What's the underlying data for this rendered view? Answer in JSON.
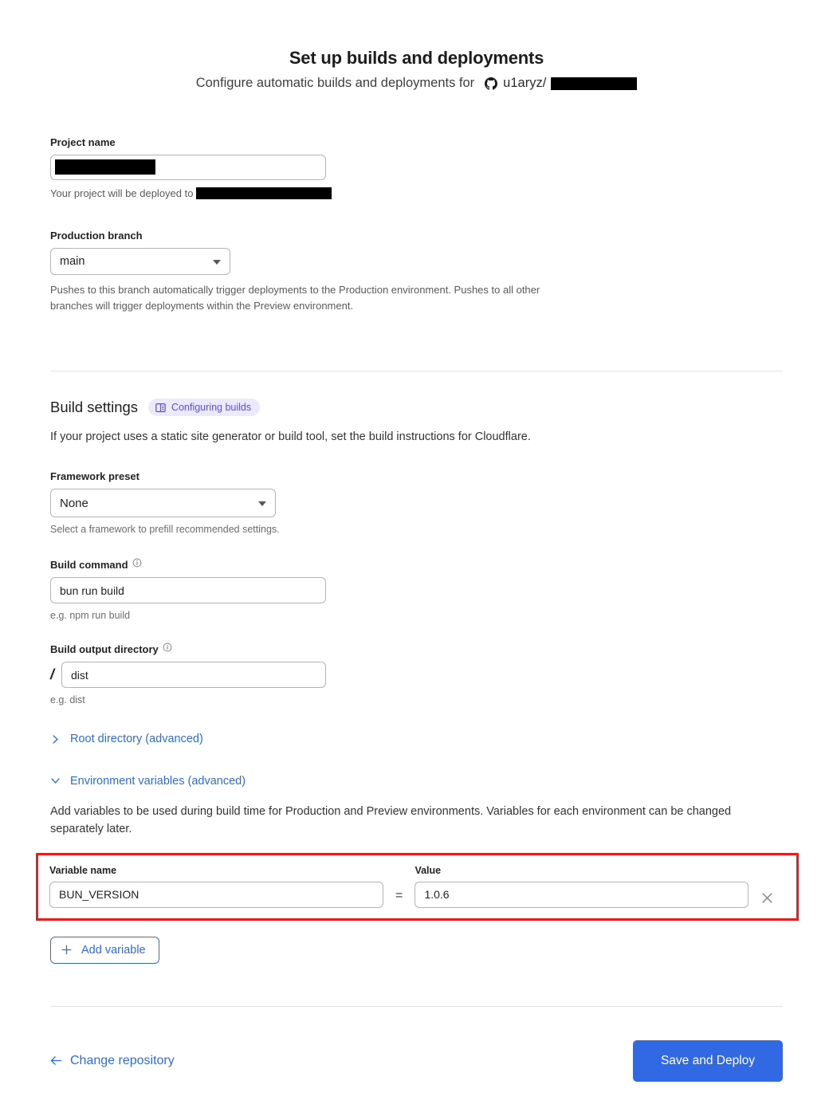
{
  "header": {
    "title": "Set up builds and deployments",
    "subtitle_text": "Configure automatic builds and deployments for",
    "repo_icon": "github-icon",
    "repo_owner": "u1aryz/",
    "repo_name_redacted": true
  },
  "project": {
    "label": "Project name",
    "value": "",
    "value_redacted": true,
    "deploy_note": "Your project will be deployed to",
    "deploy_target_redacted": true
  },
  "production_branch": {
    "label": "Production branch",
    "value": "main",
    "options": [
      "main"
    ],
    "helper": "Pushes to this branch automatically trigger deployments to the Production environment. Pushes to all other branches will trigger deployments within the Preview environment."
  },
  "build_settings": {
    "heading": "Build settings",
    "badge": {
      "label": "Configuring builds",
      "icon": "book-icon",
      "bg_color": "#ebe9fb",
      "text_color": "#5b50d6"
    },
    "description": "If your project uses a static site generator or build tool, set the build instructions for Cloudflare.",
    "framework_preset": {
      "label": "Framework preset",
      "value": "None",
      "options": [
        "None"
      ],
      "helper": "Select a framework to prefill recommended settings."
    },
    "build_command": {
      "label": "Build command",
      "info_icon": "info-icon",
      "value": "bun run build",
      "helper": "e.g. npm run build"
    },
    "build_output_directory": {
      "label": "Build output directory",
      "info_icon": "info-icon",
      "prefix": "/",
      "value": "dist",
      "helper": "e.g. dist"
    }
  },
  "disclosures": {
    "root_directory": {
      "label": "Root directory (advanced)",
      "icon": "chevron-right-icon",
      "expanded": false
    },
    "environment_variables": {
      "label": "Environment variables (advanced)",
      "icon": "chevron-down-icon",
      "expanded": true
    }
  },
  "env_vars": {
    "description": "Add variables to be used during build time for Production and Preview environments. Variables for each environment can be changed separately later.",
    "name_header": "Variable name",
    "value_header": "Value",
    "equals_sign": "=",
    "rows": [
      {
        "name": "BUN_VERSION",
        "value": "1.0.6"
      }
    ],
    "remove_icon": "close-icon",
    "add_button": {
      "label": "Add variable",
      "icon": "plus-icon"
    },
    "highlight_color": "#ee1b1b"
  },
  "footer": {
    "back_link": {
      "label": "Change repository",
      "icon": "arrow-left-icon"
    },
    "submit": {
      "label": "Save and Deploy",
      "color": "#3069e3"
    }
  }
}
